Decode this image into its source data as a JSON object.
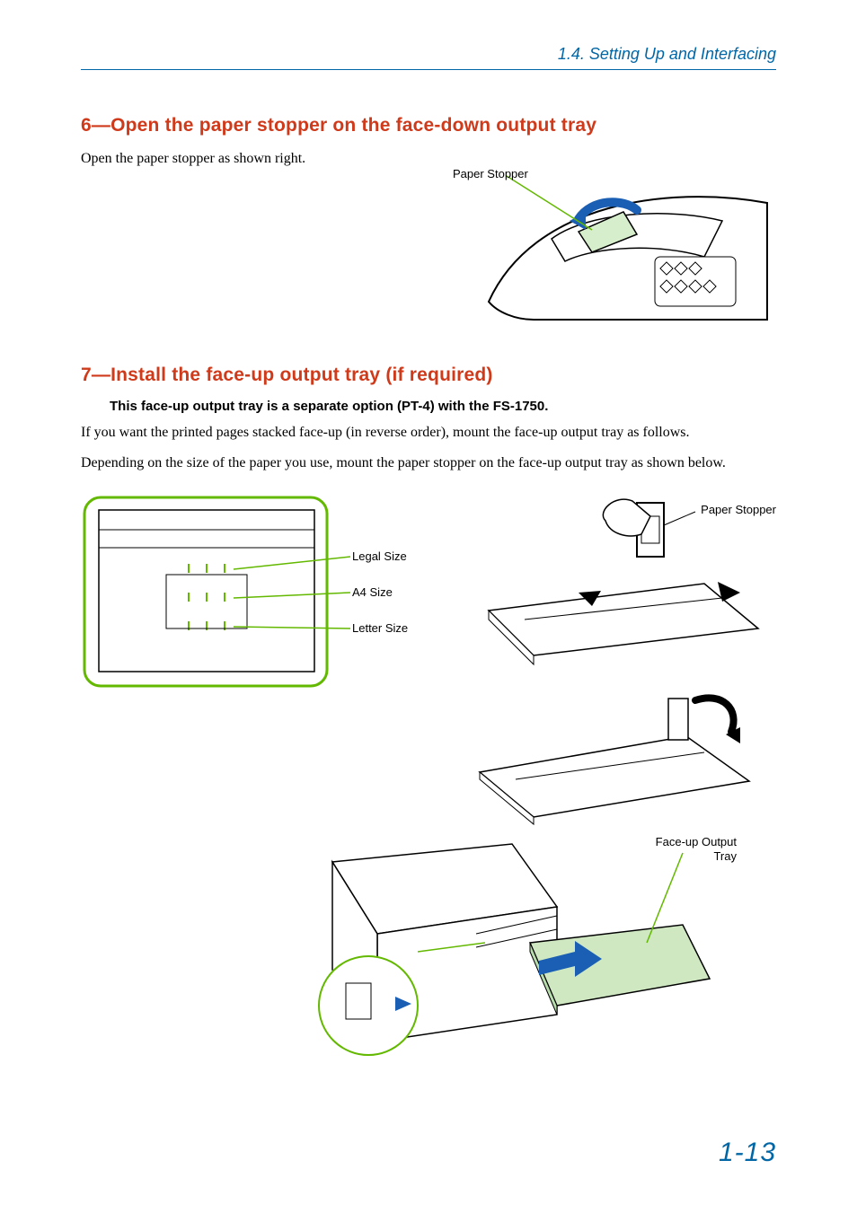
{
  "header": {
    "section_label": "1.4. Setting Up and Interfacing"
  },
  "step6": {
    "heading": "6—Open the paper stopper on the face-down output tray",
    "body": "Open the paper stopper as shown right.",
    "figure": {
      "callout": "Paper Stopper"
    }
  },
  "step7": {
    "heading": "7—Install the face-up output tray (if required)",
    "note": "This face-up output tray is a separate option (PT-4) with the FS-1750.",
    "body1": "If you want the printed pages stacked face-up (in reverse order), mount the face-up output tray as follows.",
    "body2": "Depending on the size of the paper you use, mount the paper stopper on the face-up output tray as shown below.",
    "size_labels": {
      "legal": "Legal Size",
      "a4": "A4 Size",
      "letter": "Letter Size"
    },
    "fig_stopper": {
      "callout": "Paper Stopper"
    },
    "fig_install": {
      "callout1": "Face-up Output",
      "callout2": "Tray"
    }
  },
  "page_number": "1-13"
}
